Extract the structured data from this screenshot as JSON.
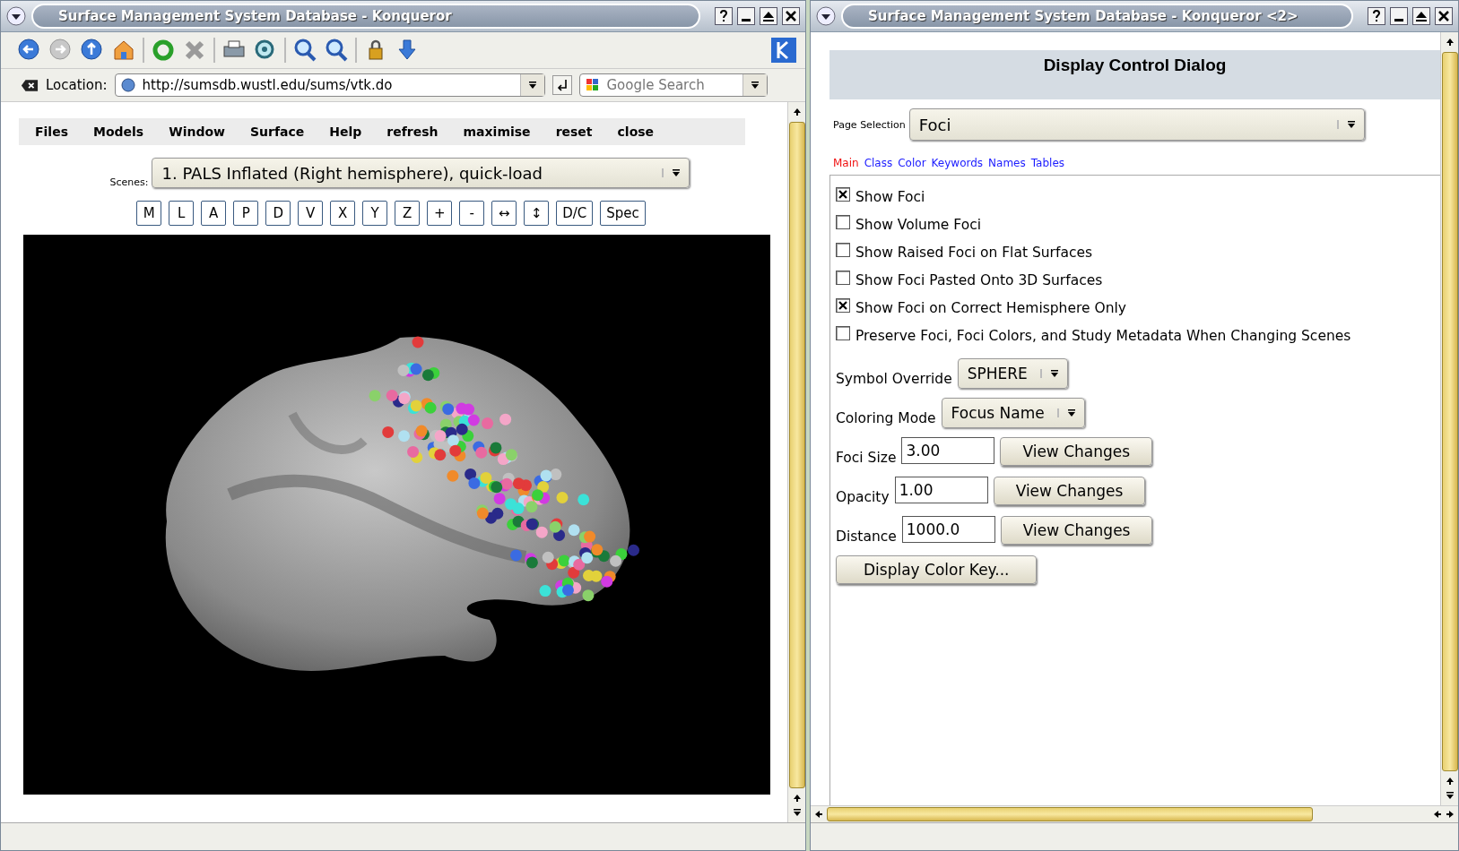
{
  "left_window": {
    "title": "Surface Management System Database - Konqueror",
    "location_label": "Location:",
    "url": "http://sumsdb.wustl.edu/sums/vtk.do",
    "search": {
      "placeholder": "Google Search"
    },
    "menu": [
      "Files",
      "Models",
      "Window",
      "Surface",
      "Help",
      "refresh",
      "maximise",
      "reset",
      "close"
    ],
    "scenes": {
      "label": "Scenes:",
      "value": "1. PALS Inflated (Right hemisphere), quick-load"
    },
    "view_buttons": [
      "M",
      "L",
      "A",
      "P",
      "D",
      "V",
      "X",
      "Y",
      "Z",
      "+",
      "-",
      "↔",
      "↕",
      "D/C",
      "Spec"
    ]
  },
  "right_window": {
    "title": "Surface Management System Database - Konqueror <2>",
    "heading": "Display Control Dialog",
    "page_selection": {
      "label": "Page Selection",
      "value": "Foci"
    },
    "tabs": [
      {
        "label": "Main",
        "selected": true
      },
      {
        "label": "Class",
        "selected": false
      },
      {
        "label": "Color",
        "selected": false
      },
      {
        "label": "Keywords",
        "selected": false
      },
      {
        "label": "Names",
        "selected": false
      },
      {
        "label": "Tables",
        "selected": false
      }
    ],
    "options": [
      {
        "label": "Show Foci",
        "checked": true
      },
      {
        "label": "Show Volume Foci",
        "checked": false
      },
      {
        "label": "Show Raised Foci on Flat Surfaces",
        "checked": false
      },
      {
        "label": "Show Foci Pasted Onto 3D Surfaces",
        "checked": false
      },
      {
        "label": "Show Foci on Correct Hemisphere Only",
        "checked": true
      },
      {
        "label": "Preserve Foci, Foci Colors, and Study Metadata When Changing Scenes",
        "checked": false
      }
    ],
    "dropdowns": [
      {
        "label": "Symbol Override",
        "value": "SPHERE"
      },
      {
        "label": "Coloring Mode",
        "value": "Focus Name"
      }
    ],
    "fields": [
      {
        "label": "Foci Size",
        "value": "3.00",
        "button": "View Changes"
      },
      {
        "label": "Opacity",
        "value": "1.00",
        "button": "View Changes"
      },
      {
        "label": "Distance",
        "value": "1000.0",
        "button": "View Changes"
      }
    ],
    "color_key_button": "Display Color Key..."
  }
}
